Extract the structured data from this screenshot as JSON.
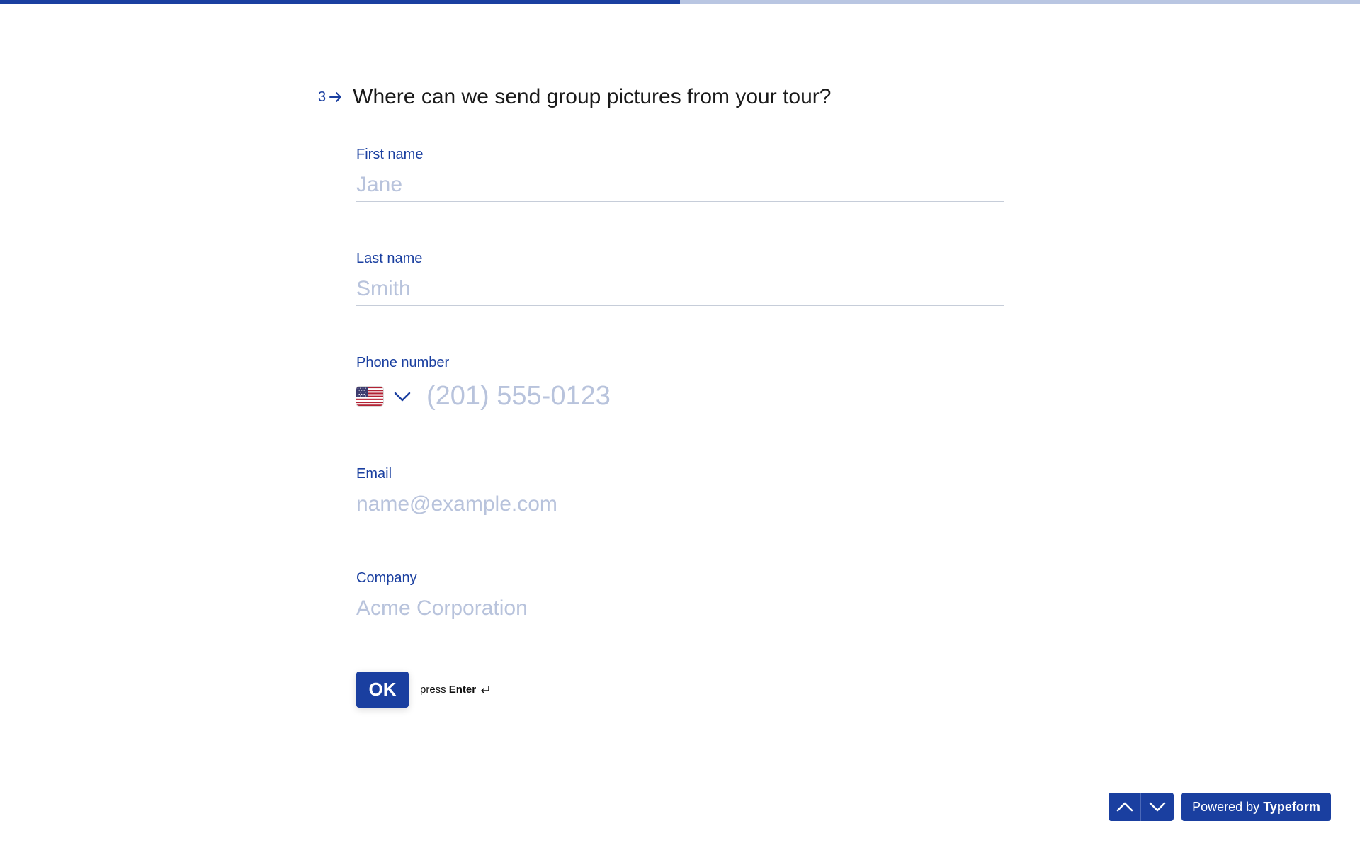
{
  "progress": {
    "fraction": 0.5
  },
  "colors": {
    "accent": "#1a3fa0",
    "placeholder": "#b8c3dc",
    "progress_track": "#b9c6e2"
  },
  "question": {
    "number": "3",
    "arrow_icon": "arrow-right-icon",
    "text": "Where can we send group pictures from your tour?"
  },
  "fields": {
    "first_name": {
      "label": "First name",
      "placeholder": "Jane",
      "value": ""
    },
    "last_name": {
      "label": "Last name",
      "placeholder": "Smith",
      "value": ""
    },
    "phone": {
      "label": "Phone number",
      "country_flag_icon": "us-flag-icon",
      "country_dropdown_icon": "chevron-down-icon",
      "placeholder": "(201) 555-0123",
      "value": ""
    },
    "email": {
      "label": "Email",
      "placeholder": "name@example.com",
      "value": ""
    },
    "company": {
      "label": "Company",
      "placeholder": "Acme Corporation",
      "value": ""
    }
  },
  "submit": {
    "ok_label": "OK",
    "hint_prefix": "press",
    "hint_key": "Enter",
    "hint_icon": "enter-return-icon"
  },
  "footer": {
    "nav_up_icon": "chevron-up-icon",
    "nav_down_icon": "chevron-down-icon",
    "powered_prefix": "Powered by",
    "powered_brand": "Typeform"
  }
}
